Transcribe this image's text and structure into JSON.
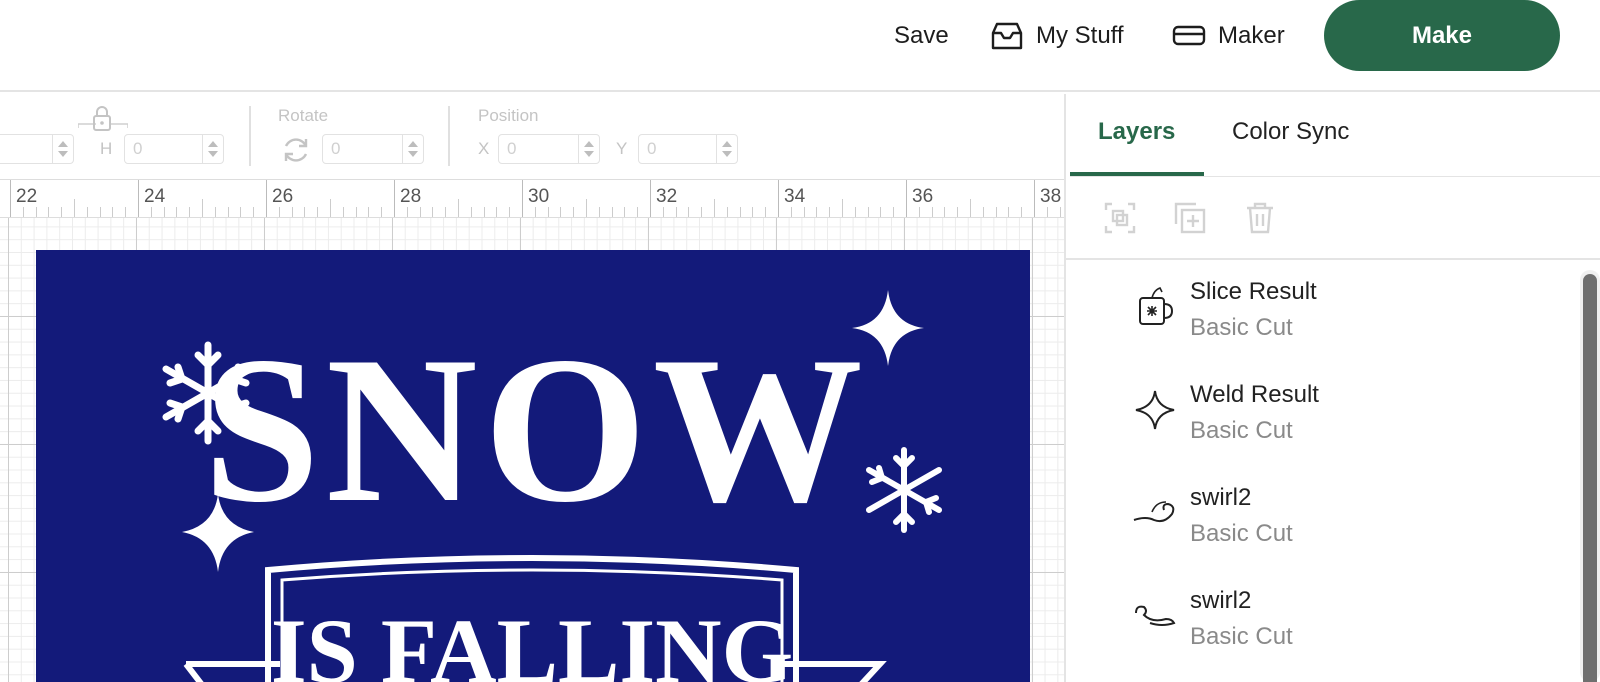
{
  "header": {
    "save_label": "Save",
    "mystuff_label": "My Stuff",
    "maker_label": "Maker",
    "make_label": "Make",
    "accent_color": "#28684a"
  },
  "toolbar": {
    "h_label": "H",
    "h_value": "0",
    "w_value": "",
    "rotate_label": "Rotate",
    "rotate_value": "0",
    "position_label": "Position",
    "x_label": "X",
    "x_value": "0",
    "y_label": "Y",
    "y_value": "0"
  },
  "ruler": {
    "ticks": [
      "22",
      "24",
      "26",
      "28",
      "30",
      "32",
      "34",
      "36",
      "38"
    ]
  },
  "design": {
    "background_color": "#131a7a",
    "title": "SNOW",
    "banner_text": "IS FALLING"
  },
  "panel": {
    "tabs": [
      {
        "label": "Layers",
        "active": true
      },
      {
        "label": "Color Sync",
        "active": false
      }
    ],
    "actions": [
      "group-icon",
      "duplicate-icon",
      "delete-icon"
    ],
    "layers": [
      {
        "name": "Slice Result",
        "sub": "Basic Cut",
        "icon": "mug-icon"
      },
      {
        "name": "Weld Result",
        "sub": "Basic Cut",
        "icon": "sparkle-icon"
      },
      {
        "name": "swirl2",
        "sub": "Basic Cut",
        "icon": "swirl-icon"
      },
      {
        "name": "swirl2",
        "sub": "Basic Cut",
        "icon": "swirl-icon"
      }
    ]
  }
}
